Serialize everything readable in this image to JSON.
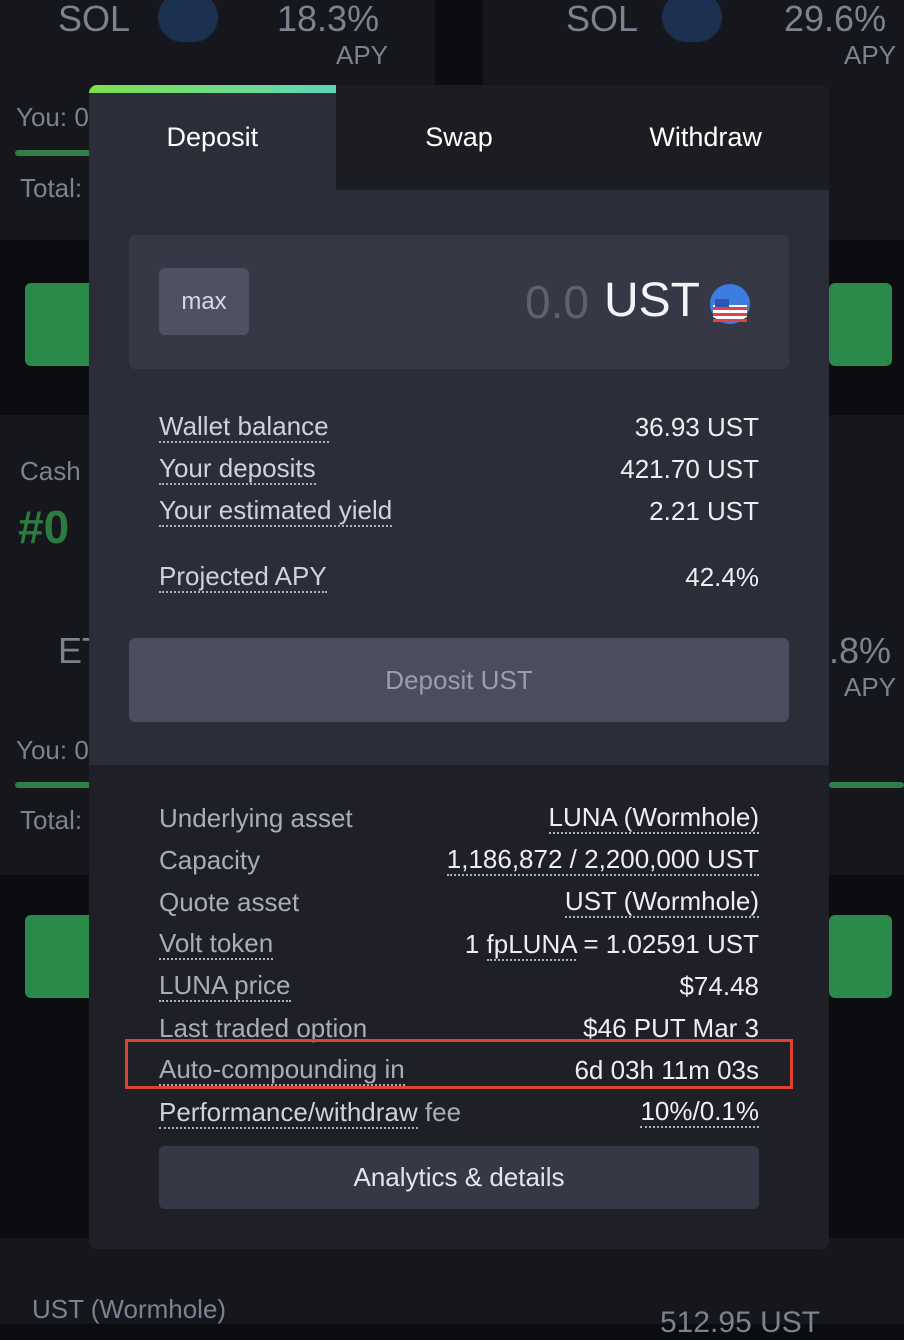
{
  "background": {
    "top_left": {
      "asset": "SOL",
      "apy": "18.3%",
      "apy_label": "APY",
      "you_label": "You: 0",
      "total_label": "Total:"
    },
    "top_right": {
      "asset": "SOL",
      "apy": "29.6%",
      "apy_label": "APY"
    },
    "middle_left": {
      "cash_label": "Cash",
      "rank": "#0",
      "asset": "ET",
      "you_label": "You: 0",
      "total_label": "Total:"
    },
    "middle_right": {
      "apy": ".8%",
      "apy_label": "APY"
    },
    "bottom_left": {
      "asset": "UST (Wormhole)"
    },
    "bottom_right": {
      "amount": "512.95 UST"
    }
  },
  "tabs": [
    {
      "label": "Deposit",
      "active": true
    },
    {
      "label": "Swap",
      "active": false
    },
    {
      "label": "Withdraw",
      "active": false
    }
  ],
  "deposit": {
    "max_label": "max",
    "amount_placeholder": "0.0",
    "currency": "UST",
    "currency_icon": "ust-icon",
    "wallet_balance_label": "Wallet balance",
    "wallet_balance_value": "36.93 UST",
    "your_deposits_label": "Your deposits",
    "your_deposits_value": "421.70 UST",
    "estimated_yield_label": "Your estimated yield",
    "estimated_yield_value": "2.21 UST",
    "projected_apy_label": "Projected APY",
    "projected_apy_value": "42.4%",
    "deposit_button_label": "Deposit UST"
  },
  "details": {
    "underlying_asset_label": "Underlying asset",
    "underlying_asset_value": "LUNA (Wormhole)",
    "capacity_label": "Capacity",
    "capacity_value": "1,186,872 / 2,200,000 UST",
    "quote_asset_label": "Quote asset",
    "quote_asset_value": "UST (Wormhole)",
    "volt_token_label": "Volt token",
    "volt_token_value_prefix": "1",
    "volt_token_value_token": "fpLUNA",
    "volt_token_value_suffix": "= 1.02591 UST",
    "luna_price_label": "LUNA price",
    "luna_price_value": "$74.48",
    "last_traded_label": "Last traded option",
    "last_traded_value": "$46 PUT Mar 3",
    "auto_compounding_label": "Auto-compounding in",
    "auto_compounding_value": "6d 03h 11m 03s",
    "fee_label_link": "Performance/withdraw",
    "fee_label_suffix": "fee",
    "fee_value": "10%/0.1%",
    "analytics_button_label": "Analytics & details"
  },
  "colors": {
    "accent_gradient_start": "#7ee04a",
    "accent_gradient_end": "#5fd6b9",
    "highlight_box": "#e0422a"
  }
}
